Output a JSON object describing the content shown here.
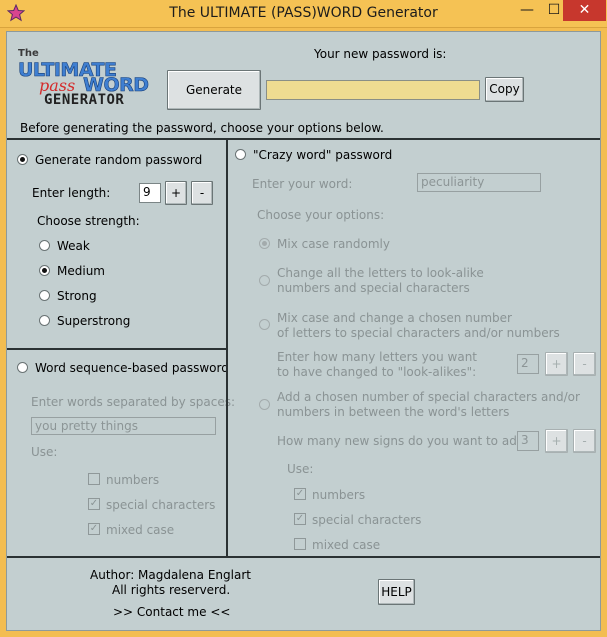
{
  "window": {
    "title": "The ULTIMATE (PASS)WORD Generator",
    "minimize_glyph": "—",
    "maximize_glyph": "☐",
    "close_glyph": "✕"
  },
  "logo": {
    "the": "The",
    "ultimate": "ULTIMATE",
    "pass": "pass",
    "word": "WORD",
    "generator": "GENERATOR"
  },
  "header": {
    "password_label": "Your new password is:",
    "generate_button": "Generate",
    "password_value": "",
    "copy_button": "Copy",
    "instructions": "Before generating the password, choose your options below."
  },
  "random": {
    "option_label": "Generate random password",
    "length_label": "Enter length:",
    "length_value": "9",
    "plus": "+",
    "minus": "-",
    "strength_label": "Choose strength:",
    "strengths": [
      "Weak",
      "Medium",
      "Strong",
      "Superstrong"
    ],
    "selected_strength": "Medium"
  },
  "wordseq": {
    "option_label": "Word sequence-based password",
    "enter_label": "Enter words separated by spaces:",
    "placeholder": "you pretty things",
    "use_label": "Use:",
    "options": [
      {
        "label": "numbers",
        "checked": false
      },
      {
        "label": "special characters",
        "checked": true
      },
      {
        "label": "mixed case",
        "checked": true
      }
    ]
  },
  "crazy": {
    "option_label": "\"Crazy word\" password",
    "enter_label": "Enter your word:",
    "word_value": "peculiarity",
    "choose_label": "Choose your options:",
    "mix_case": "Mix case randomly",
    "lookalike_line1": "Change all the letters to look-alike",
    "lookalike_line2": "numbers and special characters",
    "mixchange_line1": "Mix case and change a chosen number",
    "mixchange_line2": "of letters to special characters and/or numbers",
    "how_many_line1": "Enter how many letters you want",
    "how_many_line2": "to have changed to \"look-alikes\":",
    "how_many_value": "2",
    "add_line1": "Add a chosen number of special characters and/or",
    "add_line2": "numbers in between the word's letters",
    "new_signs_label": "How many new signs do you want to add?",
    "new_signs_value": "3",
    "plus": "+",
    "minus": "-",
    "use_label": "Use:",
    "options": [
      {
        "label": "numbers",
        "checked": true
      },
      {
        "label": "special characters",
        "checked": true
      },
      {
        "label": "mixed case",
        "checked": false
      }
    ]
  },
  "footer": {
    "author": "Author: Magdalena Englart",
    "rights": "All rights reserverd.",
    "contact": ">> Contact me <<",
    "help_button": "HELP"
  },
  "colors": {
    "titlebar": "#f5c254",
    "client": "#c3cfd0",
    "close": "#c7372d",
    "password_field": "#efdc91"
  }
}
